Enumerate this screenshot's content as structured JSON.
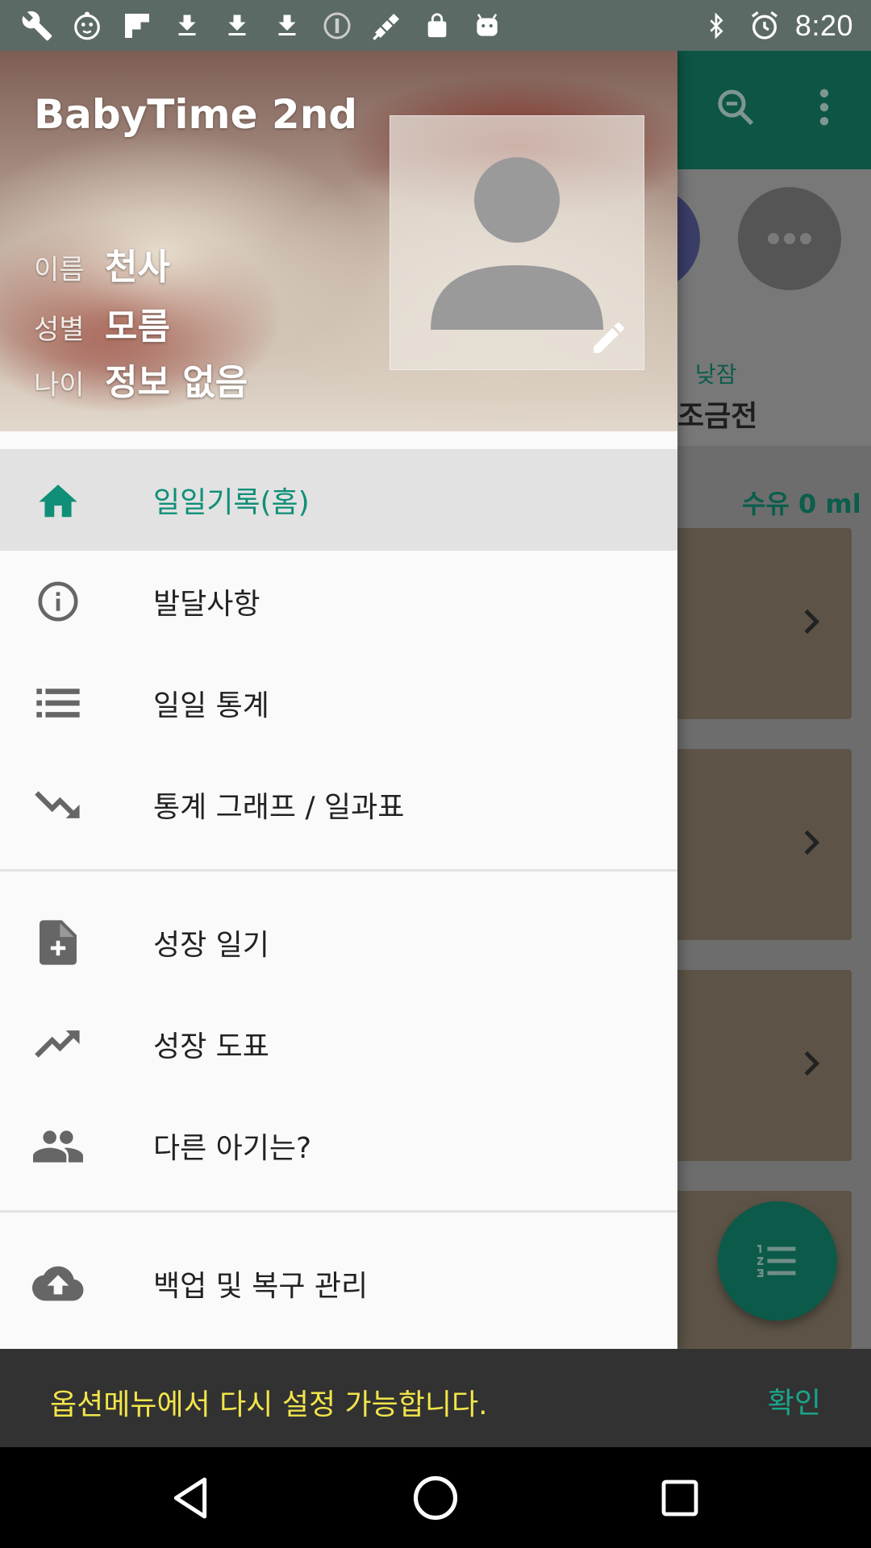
{
  "status_bar": {
    "time": "8:20",
    "icons": [
      "wrench-icon",
      "app-icon",
      "flipboard-icon",
      "download-icon",
      "download-icon",
      "download-icon",
      "info-icon",
      "satellite-icon",
      "lock-icon",
      "android-icon"
    ],
    "right_icons": [
      "bluetooth-icon",
      "alarm-icon"
    ]
  },
  "drawer": {
    "app_title": "BabyTime 2nd",
    "profile": {
      "name_label": "이름",
      "name_value": "천사",
      "gender_label": "성별",
      "gender_value": "모름",
      "age_label": "나이",
      "age_value": "정보 없음"
    },
    "menu_group_1": [
      {
        "label": "일일기록(홈)",
        "icon": "home-icon",
        "active": true
      },
      {
        "label": "발달사항",
        "icon": "info-icon"
      },
      {
        "label": "일일 통계",
        "icon": "list-icon"
      },
      {
        "label": "통계 그래프 / 일과표",
        "icon": "trending-down-icon"
      }
    ],
    "menu_group_2": [
      {
        "label": "성장 일기",
        "icon": "note-add-icon"
      },
      {
        "label": "성장 도표",
        "icon": "trending-up-icon"
      },
      {
        "label": "다른 아기는?",
        "icon": "people-icon"
      }
    ],
    "menu_group_3": [
      {
        "label": "백업 및 복구 관리",
        "icon": "cloud-upload-icon"
      }
    ]
  },
  "background": {
    "nap_label": "낮잠",
    "nap_value": "조금전",
    "feed_summary": "수유 0 ml"
  },
  "snackbar": {
    "message": "옵션메뉴에서 다시 설정 가능합니다.",
    "action": "확인"
  },
  "colors": {
    "accent": "#0f8f78",
    "toolbar": "#0d5646",
    "snackbar_message": "#f2e54a",
    "snackbar_action": "#1aa58a"
  }
}
